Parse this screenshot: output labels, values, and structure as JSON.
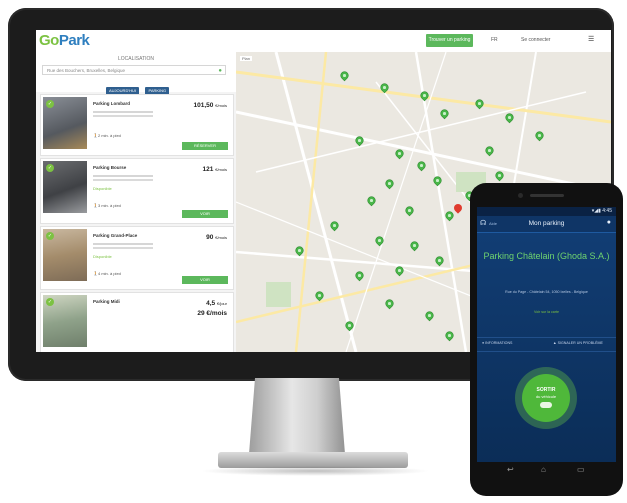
{
  "app": {
    "logo_prefix": "Go",
    "logo_suffix": "Park"
  },
  "header": {
    "cta_label": "Trouver un parking",
    "lang": "FR",
    "login": "Se connecter",
    "menu_icon": "menu-icon"
  },
  "search_panel": {
    "location_label": "LOCALISATION",
    "search_value": "Rue des Bouchers, Bruxelles, Belgique",
    "chips": [
      "AUJOURD'HUI",
      "PARKING"
    ]
  },
  "cards": [
    {
      "name": "Parking Lombard",
      "price": "101,50",
      "unit": "€/mois",
      "availability": "",
      "walk": "2 min. à pied",
      "button": "RÉSERVER"
    },
    {
      "name": "Parking Bourse",
      "price": "121",
      "unit": "€/mois",
      "availability": "Disponible",
      "walk": "3 min. à pied",
      "button": "VOIR"
    },
    {
      "name": "Parking Grand-Place",
      "price": "90",
      "unit": "€/mois",
      "availability": "Disponible",
      "walk": "4 min. à pied",
      "button": "VOIR"
    },
    {
      "name": "Parking Midi",
      "price": "4,5",
      "unit": "€/jour",
      "availability": "",
      "walk": "",
      "button": ""
    }
  ],
  "card4_extra": "29 €/mois",
  "map": {
    "zoom_label": "Plan"
  },
  "phone": {
    "status_time": "4:45",
    "app_title": "Mon parking",
    "help_label": "Aide",
    "parking_name": "Parking Châtelain (Ghoda S.A.)",
    "address": "Rue du Page - Châtelain 54, 1050 Ixelles - Belgique",
    "link": "Voir sur la carte",
    "tab_left": "INFORMATIONS",
    "tab_right": "SIGNALER UN PROBLÈME",
    "exit_title": "SORTIR",
    "exit_sub": "du véhicule"
  },
  "colors": {
    "brand_blue": "#2f7fbf",
    "brand_green": "#7cc242",
    "button_green": "#5cb85c",
    "phone_bg": "#0b2d57"
  }
}
